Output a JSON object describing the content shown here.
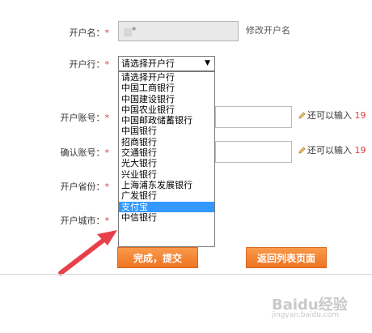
{
  "form": {
    "account_name": {
      "label": "开户名：",
      "required_mark": "*",
      "value": "*",
      "side_link": "修改开户名"
    },
    "bank": {
      "label": "开户行：",
      "required_mark": "*",
      "selected": "请选择开户行"
    },
    "account_number": {
      "label": "开户账号：",
      "required_mark": "*",
      "hint": "还可以输入 ",
      "hint_count": "19"
    },
    "confirm_number": {
      "label": "确认账号：",
      "required_mark": "*",
      "hint": "还可以输入 ",
      "hint_count": "19"
    },
    "province": {
      "label": "开户省份：",
      "required_mark": "*"
    },
    "city": {
      "label": "开户城市：",
      "required_mark": "*"
    }
  },
  "bank_options": [
    "请选择开户行",
    "中国工商银行",
    "中国建设银行",
    "中国农业银行",
    "中国邮政储蓄银行",
    "中国银行",
    "招商银行",
    "交通银行",
    "光大银行",
    "兴业银行",
    "上海浦东发展银行",
    "广发银行",
    "支付宝",
    "中信银行"
  ],
  "selected_option_index": 12,
  "buttons": {
    "submit": "完成，提交",
    "back": "返回列表页面"
  },
  "watermark": {
    "main": "Baidu经验",
    "sub": "jingyan.baidu.com"
  },
  "colors": {
    "accent": "#ee7324",
    "required": "#e4393c",
    "highlight": "#3399ff",
    "arrow": "#e8404a"
  }
}
